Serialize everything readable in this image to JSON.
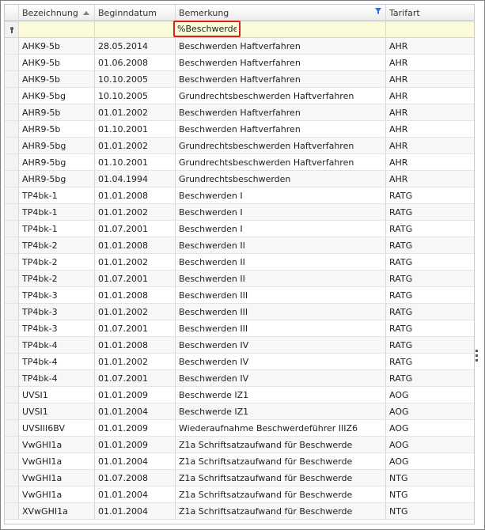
{
  "columns": [
    "Bezeichnung",
    "Beginndatum",
    "Bemerkung",
    "Tarifart"
  ],
  "filter": {
    "bemerkung_value": "%Beschwerde"
  },
  "rows": [
    [
      "AHK9-5b",
      "28.05.2014",
      "Beschwerden Haftverfahren",
      "AHR"
    ],
    [
      "AHK9-5b",
      "01.06.2008",
      "Beschwerden Haftverfahren",
      "AHR"
    ],
    [
      "AHK9-5b",
      "10.10.2005",
      "Beschwerden Haftverfahren",
      "AHR"
    ],
    [
      "AHK9-5bg",
      "10.10.2005",
      "Grundrechtsbeschwerden Haftverfahren",
      "AHR"
    ],
    [
      "AHR9-5b",
      "01.01.2002",
      "Beschwerden Haftverfahren",
      "AHR"
    ],
    [
      "AHR9-5b",
      "01.10.2001",
      "Beschwerden Haftverfahren",
      "AHR"
    ],
    [
      "AHR9-5bg",
      "01.01.2002",
      "Grundrechtsbeschwerden Haftverfahren",
      "AHR"
    ],
    [
      "AHR9-5bg",
      "01.10.2001",
      "Grundrechtsbeschwerden Haftverfahren",
      "AHR"
    ],
    [
      "AHR9-5bg",
      "01.04.1994",
      "Grundrechtsbeschwerden",
      "AHR"
    ],
    [
      "TP4bk-1",
      "01.01.2008",
      "Beschwerden I",
      "RATG"
    ],
    [
      "TP4bk-1",
      "01.01.2002",
      "Beschwerden I",
      "RATG"
    ],
    [
      "TP4bk-1",
      "01.07.2001",
      "Beschwerden I",
      "RATG"
    ],
    [
      "TP4bk-2",
      "01.01.2008",
      "Beschwerden II",
      "RATG"
    ],
    [
      "TP4bk-2",
      "01.01.2002",
      "Beschwerden II",
      "RATG"
    ],
    [
      "TP4bk-2",
      "01.07.2001",
      "Beschwerden II",
      "RATG"
    ],
    [
      "TP4bk-3",
      "01.01.2008",
      "Beschwerden III",
      "RATG"
    ],
    [
      "TP4bk-3",
      "01.01.2002",
      "Beschwerden III",
      "RATG"
    ],
    [
      "TP4bk-3",
      "01.07.2001",
      "Beschwerden III",
      "RATG"
    ],
    [
      "TP4bk-4",
      "01.01.2008",
      "Beschwerden IV",
      "RATG"
    ],
    [
      "TP4bk-4",
      "01.01.2002",
      "Beschwerden IV",
      "RATG"
    ],
    [
      "TP4bk-4",
      "01.07.2001",
      "Beschwerden IV",
      "RATG"
    ],
    [
      "UVSI1",
      "01.01.2009",
      "Beschwerde IZ1",
      "AOG"
    ],
    [
      "UVSI1",
      "01.01.2004",
      "Beschwerde IZ1",
      "AOG"
    ],
    [
      "UVSIII6BV",
      "01.01.2009",
      "Wiederaufnahme Beschwerdeführer IIIZ6",
      "AOG"
    ],
    [
      "VwGHI1a",
      "01.01.2009",
      "Z1a Schriftsatzaufwand für Beschwerde",
      "AOG"
    ],
    [
      "VwGHI1a",
      "01.01.2004",
      "Z1a Schriftsatzaufwand für Beschwerde",
      "AOG"
    ],
    [
      "VwGHI1a",
      "01.07.2008",
      "Z1a Schriftsatzaufwand für Beschwerde",
      "NTG"
    ],
    [
      "VwGHI1a",
      "01.01.2004",
      "Z1a Schriftsatzaufwand für Beschwerde",
      "NTG"
    ],
    [
      "XVwGHI1a",
      "01.01.2004",
      "Z1a Schriftsatzaufwand für Beschwerde",
      "NTG"
    ]
  ]
}
